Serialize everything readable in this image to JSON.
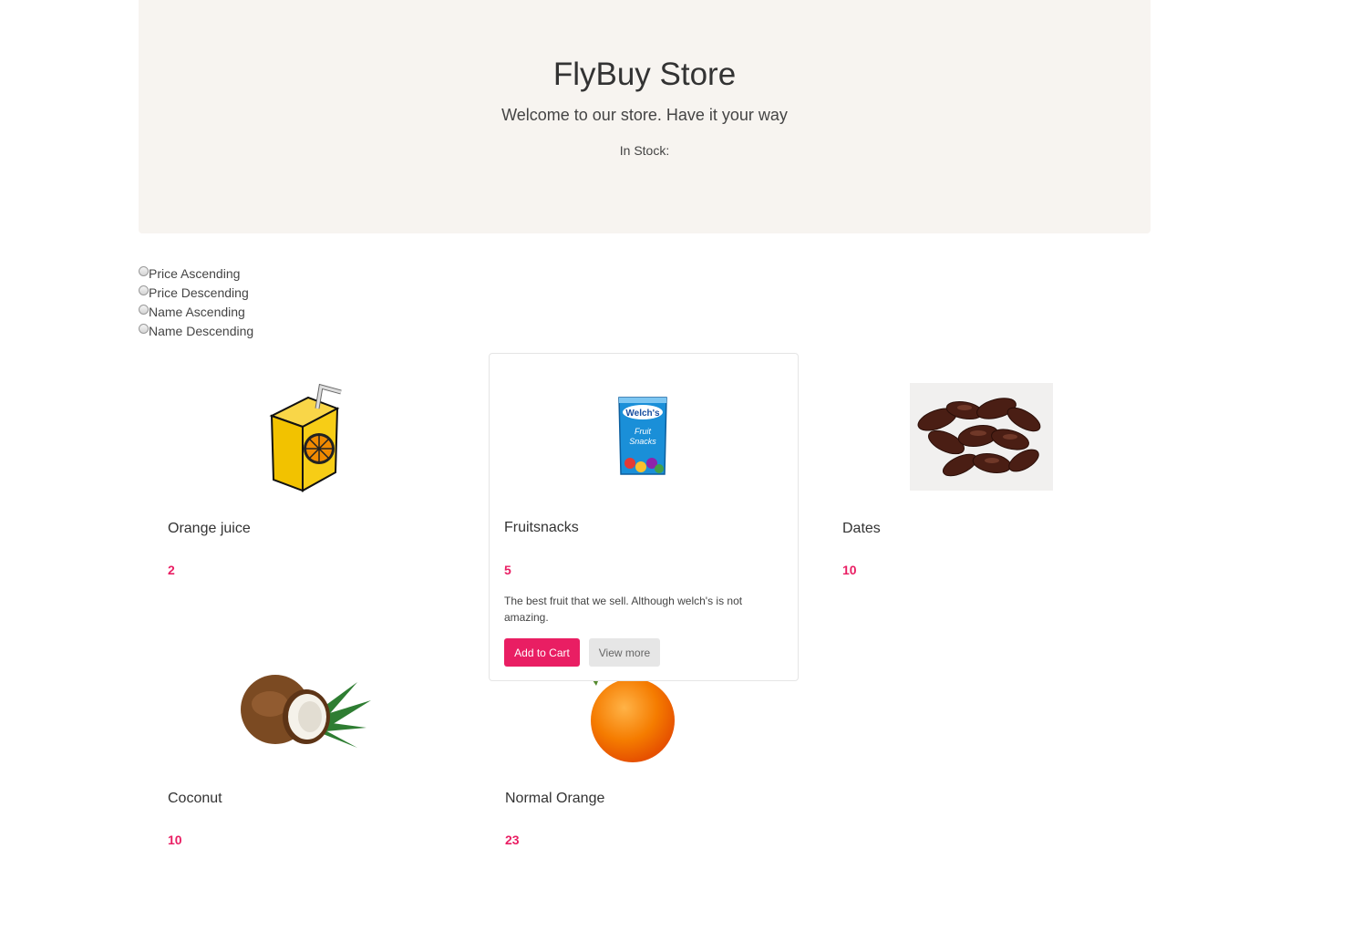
{
  "header": {
    "title": "FlyBuy Store",
    "tagline": "Welcome to our store. Have it your way",
    "stock_label": "In Stock:"
  },
  "sort": {
    "options": [
      "Price Ascending",
      "Price Descending",
      "Name Ascending",
      "Name Descending"
    ]
  },
  "products": [
    {
      "name": "Orange juice",
      "price": "2",
      "image": "juice-box-image"
    },
    {
      "name": "Fruitsnacks",
      "price": "5",
      "image": "fruit-snacks-image",
      "description": "The best fruit that we sell. Although welch's is not amazing.",
      "add_to_cart": "Add to Cart",
      "view_more": "View more"
    },
    {
      "name": "Dates",
      "price": "10",
      "image": "dates-image"
    },
    {
      "name": "Coconut",
      "price": "10",
      "image": "coconut-image"
    },
    {
      "name": "Normal Orange",
      "price": "23",
      "image": "orange-image"
    }
  ],
  "colors": {
    "accent": "#e91e63",
    "hero_bg": "#f7f4f0"
  }
}
